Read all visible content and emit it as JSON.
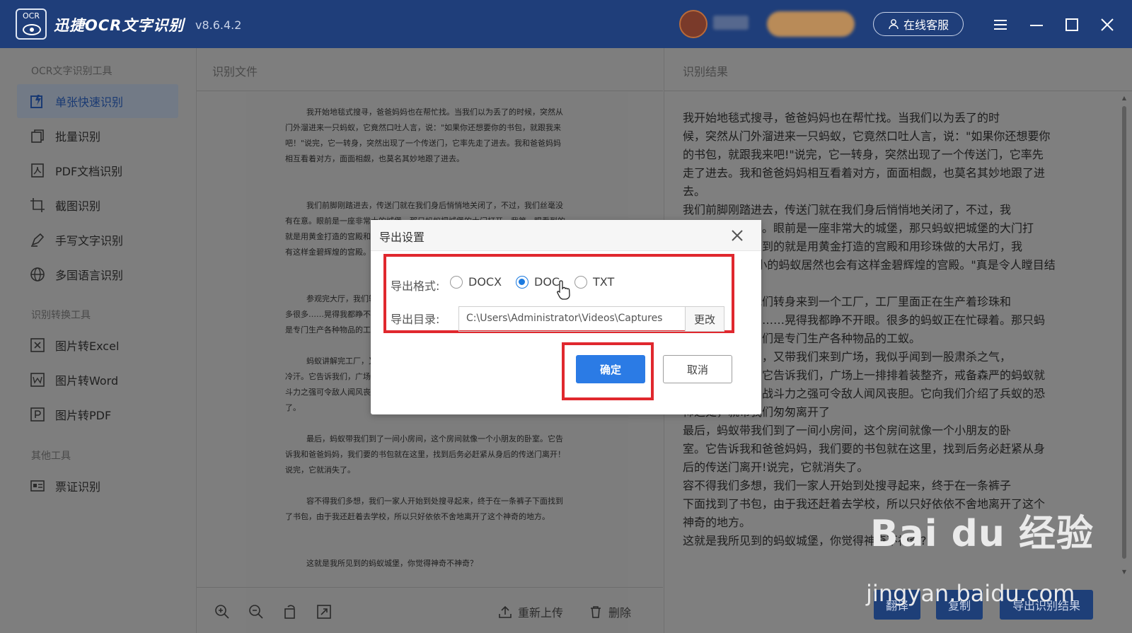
{
  "titlebar": {
    "logo_text": "OCR",
    "app_name": "迅捷OCR文字识别",
    "version": "v8.6.4.2",
    "service_button": "在线客服"
  },
  "sidebar": {
    "groups": [
      "OCR文字识别工具",
      "识别转换工具",
      "其他工具"
    ],
    "items": [
      {
        "label": "单张快速识别",
        "icon": "single-scan-icon"
      },
      {
        "label": "批量识别",
        "icon": "batch-icon"
      },
      {
        "label": "PDF文档识别",
        "icon": "pdf-icon"
      },
      {
        "label": "截图识别",
        "icon": "crop-icon"
      },
      {
        "label": "手写文字识别",
        "icon": "pen-icon"
      },
      {
        "label": "多国语言识别",
        "icon": "globe-icon"
      },
      {
        "label": "图片转Excel",
        "icon": "excel-icon"
      },
      {
        "label": "图片转Word",
        "icon": "word-icon"
      },
      {
        "label": "图片转PDF",
        "icon": "pdf-convert-icon"
      },
      {
        "label": "票证识别",
        "icon": "card-icon"
      }
    ]
  },
  "source_panel": {
    "title": "识别文件",
    "paragraphs": [
      "我开始地毯式搜寻，爸爸妈妈也在帮忙找。当我们以为丢了的时候，突然从门外溜进来一只蚂蚁，它竟然口吐人言，说：\"如果你还想要你的书包，就跟我来吧！\"说完，它一转身，突然出现了一个传送门，它率先走了进去。我和爸爸妈妈相互看着对方，面面相觑，也莫名其妙地跟了进去。",
      "我们前脚刚踏进去，传送门就在我们身后悄悄地关闭了，不过，我们丝毫没有在意。眼前是一座非常大的城堡，那只蚂蚁把城堡的大门打开，我第一眼看到的就是用黄金打造的宫殿和用珍珠做的大吊灯，我想：\"没想到小小的蚂蚁居然也会有这样金碧辉煌的宫殿。\"真是令人瞠目结舌。",
      "参观完大厅，我们转身来到一个工厂，工厂里面正在生产着珍珠和黄金，很多很多……晃得我都睁不开眼。很多的蚂蚁正在忙碌着。那只蚂蚁告诉我们，它们是专门生产各种物品的工蚁。",
      "蚂蚁讲解完工厂，又带我们来到广场，我似乎闻到一股肃杀之气，背上直冒冷汗。它告诉我们，广场上一排排着装整齐，戒备森严的蚂蚁就是兵蚁，兵蚁的战斗力之强可令敌人闻风丧胆。它向我们介绍了兵蚁的恐怖之处，就带我们匆匆离开了。",
      "最后，蚂蚁带我们到了一间小房间，这个房间就像一个小朋友的卧室。它告诉我和爸爸妈妈，我们要的书包就在这里，找到后务必赶紧从身后的传送门离开！说完，它就消失了。",
      "容不得我们多想，我们一家人开始到处搜寻起来，终于在一条裤子下面找到了书包，由于我还赶着去学校，所以只好依依不舍地离开了这个神奇的地方。",
      "这就是我所见到的蚂蚁城堡，你觉得神奇不神奇？"
    ],
    "toolbar": {
      "reupload": "重新上传",
      "delete": "删除"
    }
  },
  "result_panel": {
    "title": "识别结果",
    "lines": [
      "我开始地毯式搜寻，爸爸妈妈也在帮忙找。当我们以为丢了的时",
      "候，突然从门外溜进来一只蚂蚁，它竟然口吐人言，说：\"如果你还想要你",
      "的书包，就跟我来吧!\"说完，它一转身，突然出现了一个传送门，它率先",
      "走了进去。我和爸爸妈妈相互看着对方，面面相觑，也莫名其妙地跟了进",
      "去。",
      "我们前脚刚踏进去，传送门就在我们身后悄悄地关闭了，不过，我",
      "们丝毫没有在意。眼前是一座非常大的城堡，那只蚂蚁把城堡的大门打",
      "开，我第一眼看到的就是用黄金打造的宫殿和用珍珠做的大吊灯，我",
      "想：\"没想到小小的蚂蚁居然也会有这样金碧辉煌的宫殿。\"真是令人瞠目结",
      "舌。",
      "参观完大厅，我们转身来到一个工厂，工厂里面正在生产着珍珠和",
      "黄金，很多很多……晃得我都睁不开眼。很多的蚂蚁正在忙碌着。那只蚂",
      "蚁告诉我们，它们是专门生产各种物品的工蚁。",
      "蚂蚁讲解完工厂，又带我们来到广场，我似乎闻到一股肃杀之气，",
      "背上直冒冷汗。它告诉我们，广场上一排排着装整齐，戒备森严的蚂蚁就",
      "是兵蚁，兵蚁的战斗力之强可令敌人闻风丧胆。它向我们介绍了兵蚁的恐",
      "怖之处，就带我们匆匆离开了",
      "最后，蚂蚁带我们到了一间小房间，这个房间就像一个小朋友的卧",
      "室。它告诉我和爸爸妈妈，我们要的书包就在这里，找到后务必赶紧从身",
      "后的传送门离开!说完，它就消失了。",
      "容不得我们多想，我们一家人开始到处搜寻起来，终于在一条裤子",
      "下面找到了书包，由于我还赶着去学校，所以只好依依不舍地离开了这个",
      "神奇的地方。",
      "这就是我所见到的蚂蚁城堡，你觉得神奇不神奇?"
    ],
    "buttons": {
      "translate": "翻译",
      "copy": "复制",
      "export": "导出识别结果"
    }
  },
  "watermark": {
    "logo": "Bai du 经验",
    "url": "jingyan.baidu.com"
  },
  "dialog": {
    "title": "导出设置",
    "format_label": "导出格式:",
    "formats": [
      {
        "label": "DOCX",
        "checked": false
      },
      {
        "label": "DOC",
        "checked": true
      },
      {
        "label": "TXT",
        "checked": false
      }
    ],
    "dir_label": "导出目录:",
    "dir_value": "C:\\Users\\Administrator\\Videos\\Captures",
    "change_button": "更改",
    "ok_button": "确定",
    "cancel_button": "取消",
    "highlight_color": "#e0282e",
    "accent_color": "#2b7be5"
  }
}
